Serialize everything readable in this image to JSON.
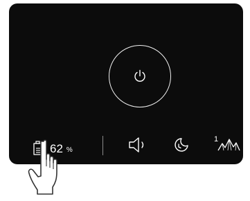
{
  "battery": {
    "icon": "battery-doc-icon",
    "value": "62",
    "unit": "%"
  },
  "controls": {
    "power_icon": "power-icon",
    "volume_icon": "speaker-icon",
    "night_icon": "moon-clock-icon",
    "mode_icon": "wave-mountain-icon",
    "mode_level": "1"
  },
  "colors": {
    "panel": "#0c0c0c",
    "foreground": "#ffffff",
    "divider": "#8a8a8a"
  }
}
